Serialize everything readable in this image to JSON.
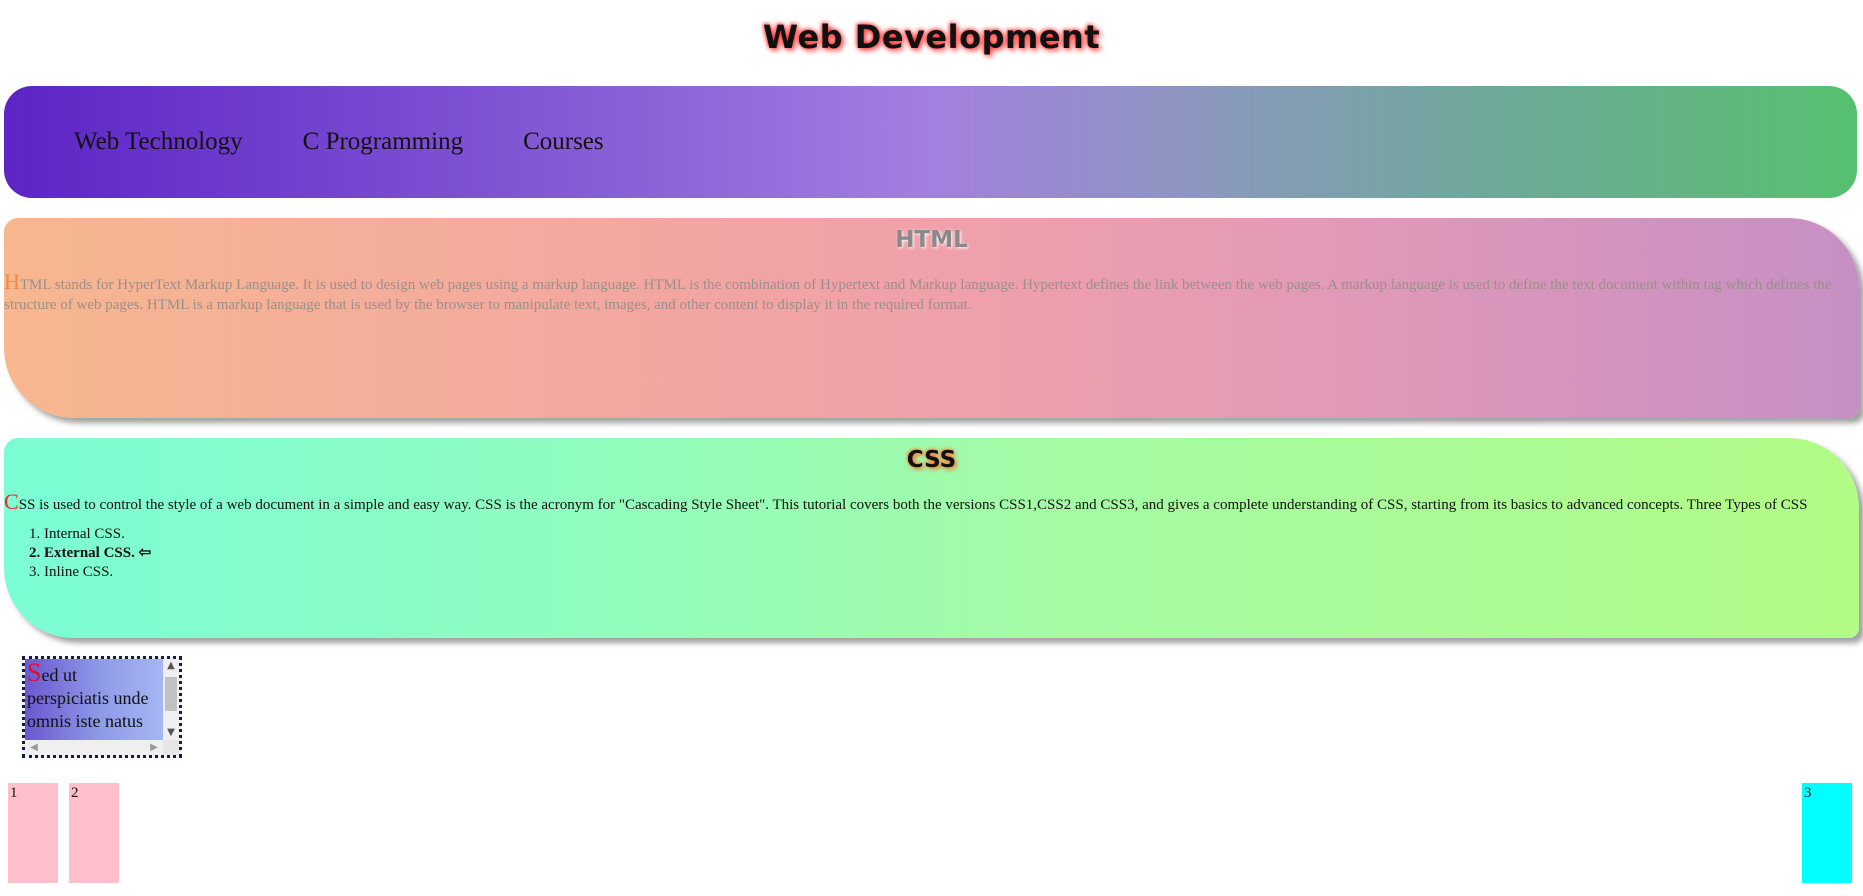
{
  "header": {
    "title": "Web Development"
  },
  "nav": {
    "items": [
      {
        "label": "Web Technology"
      },
      {
        "label": "C Programming"
      },
      {
        "label": "Courses"
      }
    ]
  },
  "html_section": {
    "title": "HTML",
    "dropcap": "H",
    "text": "TML stands for HyperText Markup Language. It is used to design web pages using a markup language. HTML is the combination of Hypertext and Markup language. Hypertext defines the link between the web pages. A markup language is used to define the text document within tag which defines the structure of web pages. HTML is a markup language that is used by the browser to manipulate text, images, and other content to display it in the required format."
  },
  "css_section": {
    "title": "CSS",
    "dropcap": "C",
    "text": "SS is used to control the style of a web document in a simple and easy way. CSS is the acronym for \"Cascading Style Sheet\". This tutorial covers both the versions CSS1,CSS2 and CSS3, and gives a complete understanding of CSS, starting from its basics to advanced concepts. Three Types of CSS",
    "list": [
      {
        "label": "Internal CSS."
      },
      {
        "label": "External CSS. ⇦"
      },
      {
        "label": "Inline CSS."
      }
    ]
  },
  "scroll_box": {
    "dropcap": "S",
    "text": "ed ut perspiciatis unde omnis iste natus"
  },
  "boxes": {
    "box1": "1",
    "box2": "2",
    "box3": "3"
  },
  "colors": {
    "title_glow": "#ff2a2a",
    "box_pink": "#ffc0cb",
    "box_cyan": "#00ffff"
  }
}
